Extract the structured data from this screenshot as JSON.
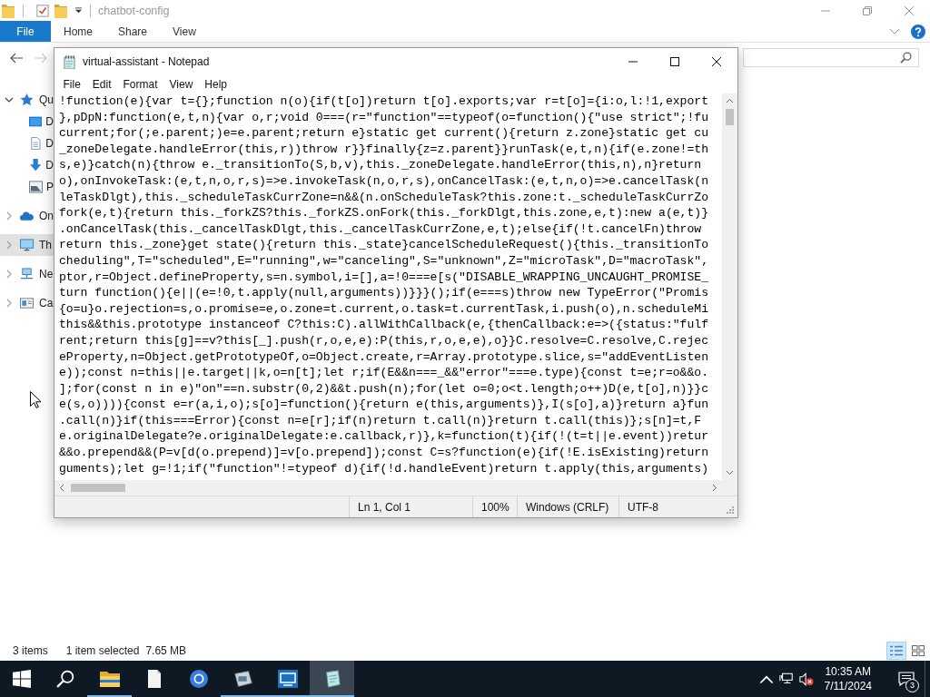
{
  "explorer": {
    "title": "chatbot-config",
    "ribbon_tabs": [
      {
        "label": "File",
        "selected": true
      },
      {
        "label": "Home",
        "selected": false
      },
      {
        "label": "Share",
        "selected": false
      },
      {
        "label": "View",
        "selected": false
      }
    ],
    "nav": [
      {
        "label": "Qu",
        "kind": "star",
        "expanded": true,
        "selected": false,
        "children": [
          {
            "label": "D",
            "kind": "desktop",
            "selected": false
          },
          {
            "label": "D",
            "kind": "documents",
            "selected": false
          },
          {
            "label": "D",
            "kind": "downloads",
            "selected": false
          },
          {
            "label": "P",
            "kind": "pictures",
            "selected": false
          }
        ]
      },
      {
        "label": "On",
        "kind": "cloud",
        "expanded": false,
        "selected": false
      },
      {
        "label": "Th",
        "kind": "computer",
        "expanded": false,
        "selected": true
      },
      {
        "label": "Ne",
        "kind": "network",
        "expanded": false,
        "selected": false
      },
      {
        "label": "Ca",
        "kind": "card",
        "expanded": false,
        "selected": false
      }
    ],
    "status": {
      "count": "3 items",
      "selection": "1 item selected",
      "size": "7.65 MB"
    },
    "views": [
      {
        "kind": "details",
        "selected": true
      },
      {
        "kind": "large-icons",
        "selected": false
      }
    ]
  },
  "notepad": {
    "title": "virtual-assistant - Notepad",
    "menu": [
      "File",
      "Edit",
      "Format",
      "View",
      "Help"
    ],
    "lines": [
      "!function(e){var t={};function n(o){if(t[o])return t[o].exports;var r=t[o]={i:o,l:!1,export",
      "},pDpN:function(e,t,n){var o,r;void 0===(r=\"function\"==typeof(o=function(){\"use strict\";!fu",
      "current;for(;e.parent;)e=e.parent;return e}static get current(){return z.zone}static get cu",
      "_zoneDelegate.handleError(this,r))throw r}}finally{z=z.parent}}runTask(e,t,n){if(e.zone!=th",
      "s,e)}catch(n){throw e._transitionTo(S,b,v),this._zoneDelegate.handleError(this,n),n}return",
      "o),onInvokeTask:(e,t,n,o,r,s)=>e.invokeTask(n,o,r,s),onCancelTask:(e,t,n,o)=>e.cancelTask(n",
      "leTaskDlgt),this._scheduleTaskCurrZone=n&&(n.onScheduleTask?this.zone:t._scheduleTaskCurrZo",
      "fork(e,t){return this._forkZS?this._forkZS.onFork(this._forkDlgt,this.zone,e,t):new a(e,t)}",
      ".onCancelTask(this._cancelTaskDlgt,this._cancelTaskCurrZone,e,t);else{if(!t.cancelFn)throw",
      "return this._zone}get state(){return this._state}cancelScheduleRequest(){this._transitionTo",
      "cheduling\",T=\"scheduled\",E=\"running\",w=\"canceling\",S=\"unknown\",Z=\"microTask\",D=\"macroTask\",",
      "ptor,r=Object.defineProperty,s=n.symbol,i=[],a=!0===e[s(\"DISABLE_WRAPPING_UNCAUGHT_PROMISE_",
      "turn function(){e||(e=!0,t.apply(null,arguments))}}}();if(e===s)throw new TypeError(\"Promis",
      "{o=u}o.rejection=s,o.promise=e,o.zone=t.current,o.task=t.currentTask,i.push(o),n.scheduleMi",
      "this&&this.prototype instanceof C?this:C).allWithCallback(e,{thenCallback:e=>({status:\"fulf",
      "rent;return this[g]==v?this[_].push(r,o,e,e):P(this,r,o,e,e),o}}C.resolve=C.resolve,C.rejec",
      "eProperty,n=Object.getPrototypeOf,o=Object.create,r=Array.prototype.slice,s=\"addEventListen",
      "e));const n=this||e.target||k,o=n[t];let r;if(E&&n===_&&\"error\"===e.type){const t=e;r=o&&o.",
      "];for(const n in e)\"on\"==n.substr(0,2)&&t.push(n);for(let o=0;o<t.length;o++)D(e,t[o],n)}}c",
      "e(s,o)))){const e=r(a,i,o);s[o]=function(){return e(this,arguments)},I(s[o],a)}return a}fun",
      ".call(n)}if(this===Error){const n=e[r];if(n)return t.call(n)}return t.call(this)};s[n]=t,F",
      "e.originalDelegate?e.originalDelegate:e.callback,r)},k=function(t){if(!(t=t||e.event))retur",
      "&&o.prepend&&(P=v[d(o.prepend)]=v[o.prepend]);const C=s?function(e){if(!E.isExisting)return",
      "guments);let g=!1;if(\"function\"!=typeof d){if(!d.handleEvent)return t.apply(this,arguments)"
    ],
    "status": {
      "position": "Ln 1, Col 1",
      "zoom": "100%",
      "line_ending": "Windows (CRLF)",
      "encoding": "UTF-8"
    }
  },
  "taskbar": {
    "apps": [
      {
        "kind": "folder",
        "running": true,
        "selected": false
      },
      {
        "kind": "document",
        "running": false,
        "selected": false
      },
      {
        "kind": "browser",
        "running": false,
        "selected": false
      },
      {
        "kind": "gadget",
        "running": true,
        "selected": false
      },
      {
        "kind": "terminal",
        "running": true,
        "selected": false
      },
      {
        "kind": "notepad",
        "running": true,
        "selected": true
      }
    ],
    "time": "10:35 AM",
    "date": "7/11/2024",
    "notifications": "3"
  }
}
